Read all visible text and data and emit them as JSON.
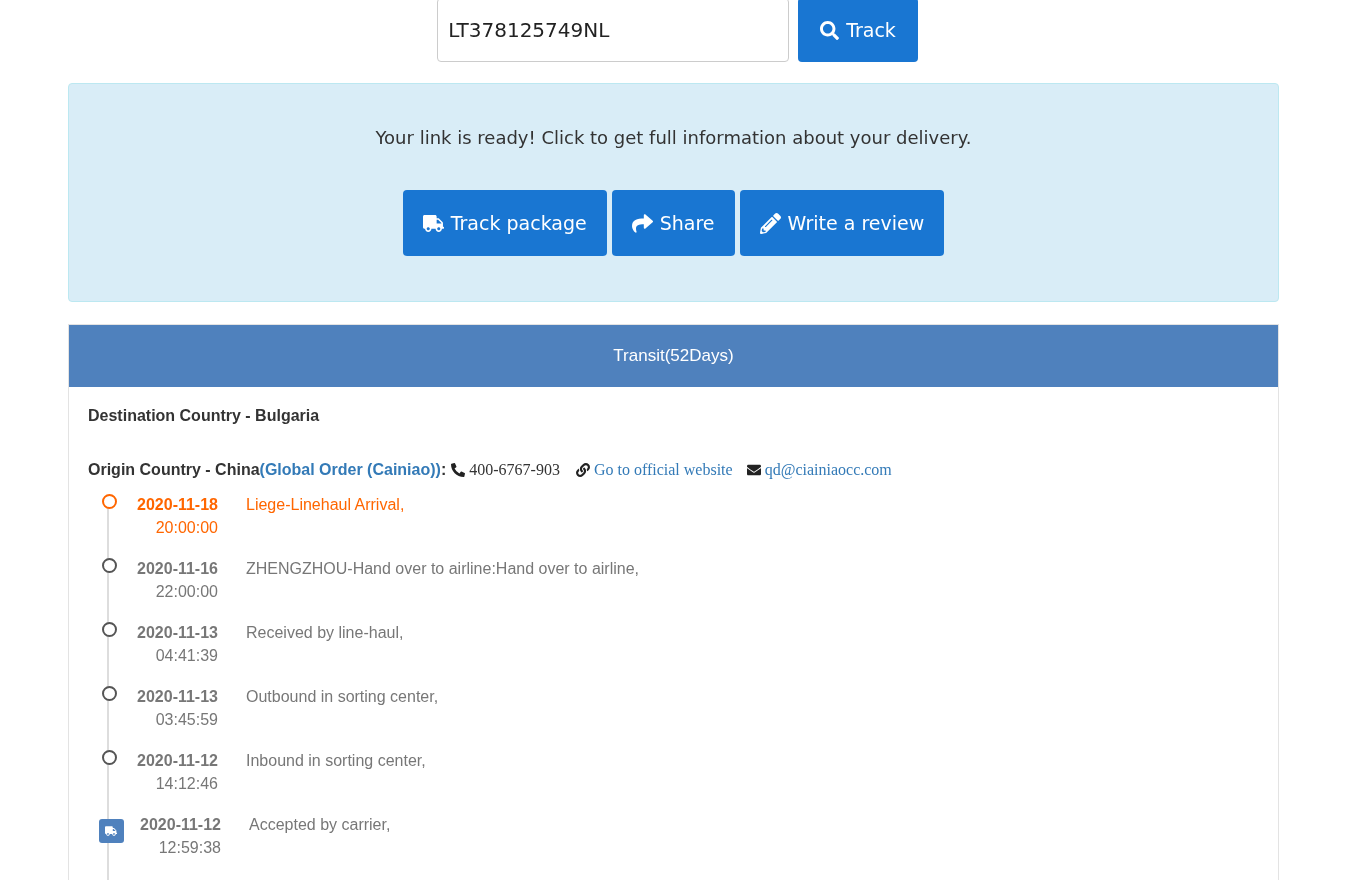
{
  "search": {
    "value": "LT378125749NL",
    "button": "Track"
  },
  "notice": {
    "message": "Your link is ready! Click to get full information about your delivery.",
    "buttons": [
      {
        "kind": "truck",
        "label": "Track package"
      },
      {
        "kind": "share",
        "label": "Share"
      },
      {
        "kind": "pencil",
        "label": "Write a review"
      }
    ]
  },
  "panel": {
    "title": "Transit(52Days)",
    "destination": "Destination Country - Bulgaria",
    "origin": {
      "label": "Origin Country - China",
      "carrier": "(Global Order (Cainiao))",
      "colon": ":",
      "phone": "400-6767-903",
      "website": "Go to official website",
      "email": "qd@ciainiaocc.com"
    },
    "events": [
      {
        "kind": "latest",
        "date": "2020-11-18",
        "time": "20:00:00",
        "description": "Liege-Linehaul Arrival,"
      },
      {
        "kind": "normal",
        "date": "2020-11-16",
        "time": "22:00:00",
        "description": "ZHENGZHOU-Hand over to airline:Hand over to airline,"
      },
      {
        "kind": "normal",
        "date": "2020-11-13",
        "time": "04:41:39",
        "description": "Received by line-haul,"
      },
      {
        "kind": "normal",
        "date": "2020-11-13",
        "time": "03:45:59",
        "description": "Outbound in sorting center,"
      },
      {
        "kind": "normal",
        "date": "2020-11-12",
        "time": "14:12:46",
        "description": "Inbound in sorting center,"
      },
      {
        "kind": "origin",
        "date": "2020-11-12",
        "time": "12:59:38",
        "description": "Accepted by carrier,"
      }
    ]
  }
}
